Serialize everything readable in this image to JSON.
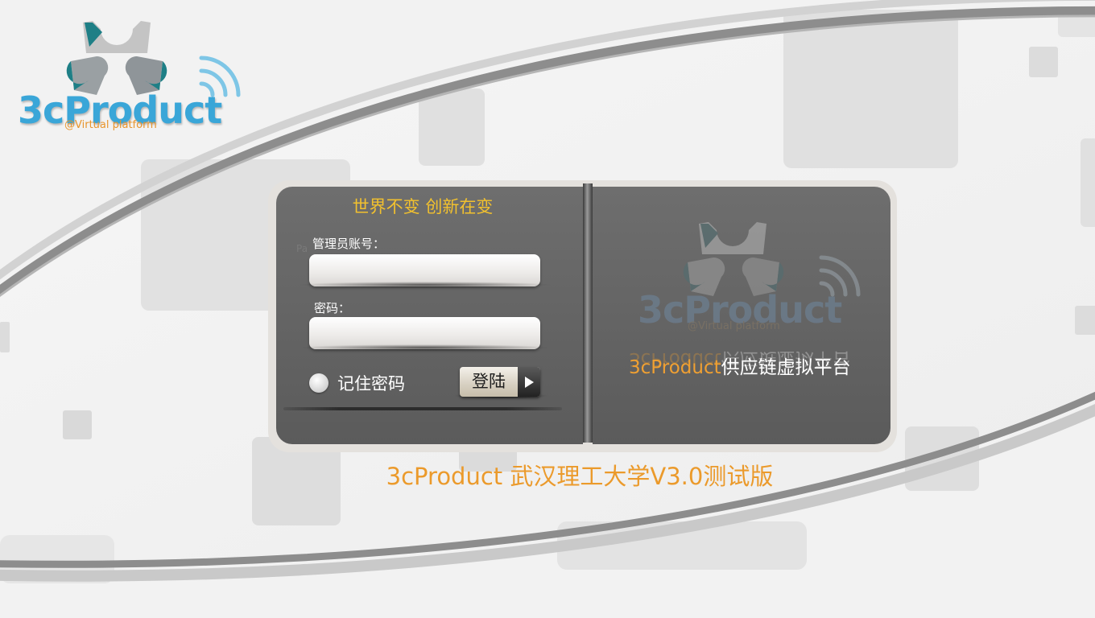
{
  "brand": {
    "logo_text": "3cProduct",
    "logo_sub": "@Virtual platform"
  },
  "login": {
    "slogan": "世界不变 创新在变",
    "ghost_hint": "Pa",
    "account_label": "管理员账号：",
    "account_value": "",
    "password_label": "密码：",
    "password_value": "",
    "remember_label": "记住密码",
    "remember_checked": false,
    "submit_label": "登陆"
  },
  "side": {
    "title_accent": "3cProduct",
    "title_rest": "供应链虚拟平台"
  },
  "footer": {
    "version": "3cProduct 武汉理工大学V3.0测试版"
  },
  "colors": {
    "brand_blue": "#3aa6d8",
    "brand_orange": "#eb9a2b",
    "slogan_yellow": "#f2c12e",
    "panel_gray": "#646464",
    "gear_teal": "#1e7f86",
    "gear_gray": "#c4c4c4"
  },
  "icons": {
    "logo_mark": "three-gears-icon",
    "signal": "wireless-signal-icon",
    "submit_arrow": "play-arrow-icon",
    "remember_toggle": "radio-button-icon"
  }
}
